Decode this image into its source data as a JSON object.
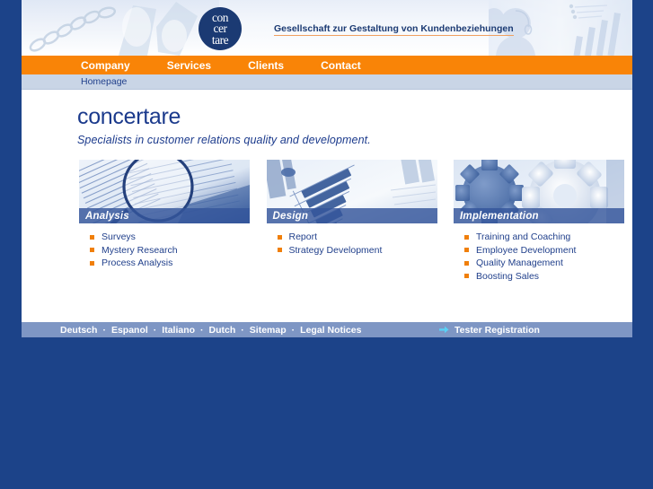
{
  "header": {
    "logo": {
      "name": "concertare-logo",
      "lines": [
        "con",
        "cer",
        "tare"
      ]
    },
    "tagline": "Gesellschaft zur Gestaltung von Kundenbeziehungen"
  },
  "nav": {
    "items": [
      {
        "label": "Company"
      },
      {
        "label": "Services"
      },
      {
        "label": "Clients"
      },
      {
        "label": "Contact"
      }
    ]
  },
  "breadcrumb": {
    "current": "Homepage"
  },
  "brand": {
    "title": "concertare",
    "subtitle": "Specialists in customer relations quality and development."
  },
  "panels": [
    {
      "caption": "Analysis",
      "image": "magnifying-glass-over-newspaper",
      "items": [
        "Surveys",
        "Mystery Research",
        "Process Analysis"
      ]
    },
    {
      "caption": "Design",
      "image": "bar-chart-printout",
      "items": [
        "Report",
        "Strategy Development"
      ]
    },
    {
      "caption": "Implementation",
      "image": "interlocking-gears",
      "items": [
        "Training and Coaching",
        "Employee Development",
        "Quality Management",
        "Boosting Sales"
      ]
    }
  ],
  "footer": {
    "links": [
      "Deutsch",
      "Espanol",
      "Italiano",
      "Dutch",
      "Sitemap",
      "Legal Notices"
    ],
    "separator": "·",
    "cta": "Tester Registration"
  },
  "colors": {
    "page_background": "#1c4389",
    "nav_orange": "#f98407",
    "breadcrumb_blue": "#c9d5e6",
    "footer_blue": "#7e96c4",
    "brand_blue": "#1b3a8c",
    "bullet_orange": "#f07f0a",
    "caption_blue": "#34569b",
    "cta_arrow": "#5ad0f5"
  }
}
